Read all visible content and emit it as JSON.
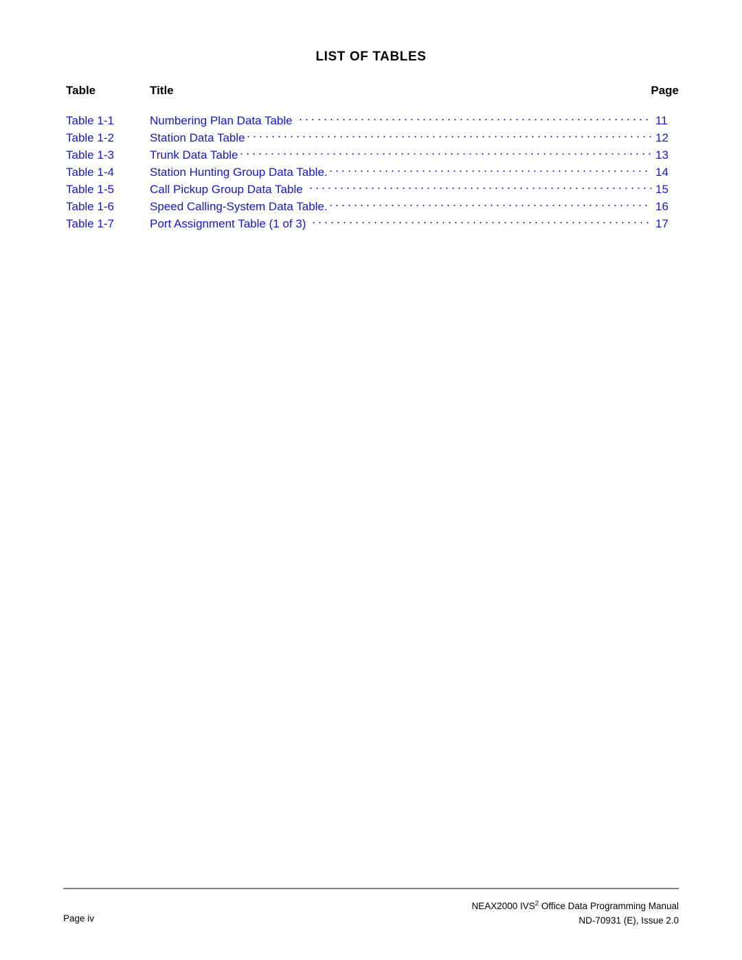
{
  "page": {
    "heading": "LIST OF TABLES"
  },
  "columns": {
    "table_header": "Table",
    "title_header": "Title",
    "page_header": "Page"
  },
  "entries": [
    {
      "label": "Table 1-1",
      "title": "Numbering Plan Data Table",
      "page": "11",
      "leader_gap": true
    },
    {
      "label": "Table 1-2",
      "title": "Station Data Table",
      "page": "12",
      "leader_gap": false
    },
    {
      "label": "Table 1-3",
      "title": "Trunk Data Table",
      "page": "13",
      "leader_gap": false
    },
    {
      "label": "Table 1-4",
      "title": "Station Hunting Group Data Table.",
      "page": "14",
      "leader_gap": false
    },
    {
      "label": "Table 1-5",
      "title": "Call Pickup Group Data Table",
      "page": "15",
      "leader_gap": true
    },
    {
      "label": "Table 1-6",
      "title": "Speed Calling-System Data Table.",
      "page": "16",
      "leader_gap": false
    },
    {
      "label": "Table 1-7",
      "title": "Port Assignment Table (1 of 3)",
      "page": "17",
      "leader_gap": true
    }
  ],
  "footer": {
    "page_label": "Page iv",
    "manual_prefix": "NEAX2000 IVS",
    "manual_superscript": "2",
    "manual_suffix": " Office Data Programming Manual",
    "document_id": "ND-70931 (E), Issue 2.0"
  },
  "colors": {
    "entry_blue": "#1414e6",
    "heading_black": "#000000",
    "rule_gray": "#808080",
    "background": "#ffffff"
  }
}
